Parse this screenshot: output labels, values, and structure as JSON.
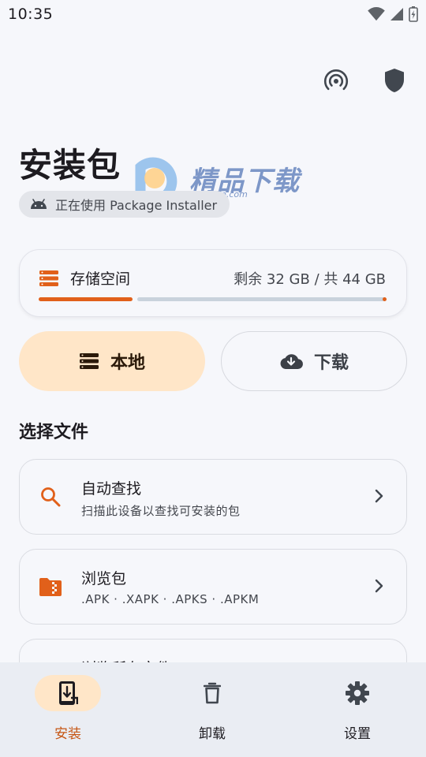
{
  "status_bar": {
    "time": "10:35",
    "icons": [
      "wifi-icon",
      "signal-icon",
      "battery-charging-icon"
    ]
  },
  "top_actions": [
    "broadcast-icon",
    "shield-icon"
  ],
  "page": {
    "title": "安装包",
    "installer_chip": {
      "icon": "android-icon",
      "text": "正在使用 Package Installer"
    }
  },
  "watermark": {
    "text": "精品下载",
    "url": "www.j9p.com"
  },
  "storage": {
    "label": "存储空间",
    "summary": "剩余 32 GB / 共 44 GB",
    "used_fraction": 0.27,
    "accent": "#e1601a"
  },
  "source_toggle": {
    "local_label": "本地",
    "download_label": "下载",
    "selected": "本地"
  },
  "section": {
    "title": "选择文件"
  },
  "options": [
    {
      "icon": "search-icon",
      "title": "自动查找",
      "subtitle": "扫描此设备以查找可安装的包"
    },
    {
      "icon": "zip-folder-icon",
      "title": "浏览包",
      "subtitle": ".APK · .XAPK · .APKS · .APKM"
    },
    {
      "icon": "folder-icon",
      "title": "浏览所有文件",
      "subtitle": ""
    }
  ],
  "bottom_nav": {
    "items": [
      {
        "label": "安装",
        "icon": "phone-install-icon",
        "active": true
      },
      {
        "label": "卸载",
        "icon": "trash-icon",
        "active": false
      },
      {
        "label": "设置",
        "icon": "gear-icon",
        "active": false
      }
    ]
  },
  "colors": {
    "accent": "#e1601a",
    "accent_container": "#ffe6c8",
    "background": "#f6f7fb"
  }
}
